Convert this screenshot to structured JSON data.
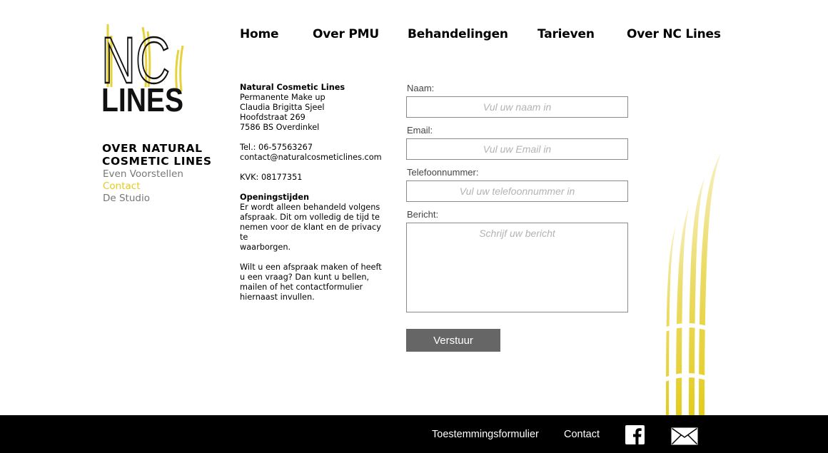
{
  "brand": {
    "logo_text_top": "NC",
    "logo_text_bottom": "LINES",
    "accent_color": "#e3cc1c"
  },
  "nav": {
    "items": [
      {
        "label": "Home"
      },
      {
        "label": "Over PMU"
      },
      {
        "label": "Behandelingen"
      },
      {
        "label": "Tarieven"
      },
      {
        "label": "Over NC Lines"
      }
    ]
  },
  "sidebar": {
    "heading": "OVER NATURAL COSMETIC LINES",
    "links": [
      {
        "label": "Even Voorstellen",
        "active": false
      },
      {
        "label": "Contact",
        "active": true
      },
      {
        "label": "De Studio",
        "active": false
      }
    ]
  },
  "contact_info": {
    "company": "Natural Cosmetic Lines",
    "address_lines": [
      "Permanente Make up",
      "Claudia Brigitta Sjeel",
      "Hoofdstraat 269",
      "7586 BS Overdinkel"
    ],
    "phone": "Tel.: 06-57563267",
    "email": "contact@naturalcosmeticlines.com",
    "kvk": "KVK: 08177351",
    "hours_title": "Openingstijden",
    "hours_text_lines": [
      "Er wordt alleen behandeld volgens",
      "afspraak. Dit om volledig de tijd te",
      "nemen voor de klant en de privacy te",
      "waarborgen."
    ],
    "cta_lines": [
      "Wilt u een afspraak maken of heeft",
      "u een vraag? Dan kunt u bellen,",
      "mailen of het contactformulier",
      "hiernaast invullen."
    ]
  },
  "form": {
    "name_label": "Naam:",
    "name_placeholder": "Vul uw naam in",
    "name_value": "",
    "email_label": "Email:",
    "email_placeholder": "Vul uw Email in",
    "email_value": "",
    "phone_label": "Telefoonnummer:",
    "phone_placeholder": "Vul uw telefoonnummer in",
    "phone_value": "",
    "message_label": "Bericht:",
    "message_placeholder": "Schrijf uw bericht",
    "message_value": "",
    "submit_label": "Verstuur"
  },
  "footer": {
    "consent_link": "Toestemmingsformulier",
    "contact_link": "Contact",
    "icons": [
      "facebook-icon",
      "mail-icon"
    ]
  }
}
